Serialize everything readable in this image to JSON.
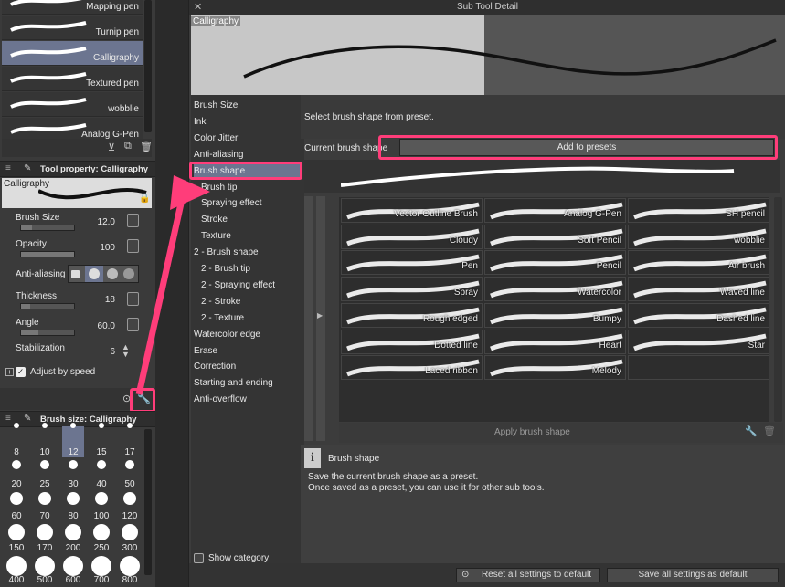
{
  "pens": [
    {
      "label": "Mapping pen",
      "selected": false
    },
    {
      "label": "Turnip pen",
      "selected": false
    },
    {
      "label": "Calligraphy",
      "selected": true
    },
    {
      "label": "Textured pen",
      "selected": false
    },
    {
      "label": "wobblie",
      "selected": false
    },
    {
      "label": "Analog G-Pen",
      "selected": false
    }
  ],
  "tool_property": {
    "header": "Tool property: Calligraphy",
    "preview_label": "Calligraphy",
    "brush_size": {
      "label": "Brush Size",
      "value": "12.0",
      "fraction": 0.2
    },
    "opacity": {
      "label": "Opacity",
      "value": "100",
      "fraction": 1.0
    },
    "anti_aliasing": {
      "label": "Anti-aliasing"
    },
    "thickness": {
      "label": "Thickness",
      "value": "18",
      "fraction": 0.18
    },
    "angle": {
      "label": "Angle",
      "value": "60.0",
      "fraction": 0.33
    },
    "stabilization": {
      "label": "Stabilization",
      "value": "6"
    },
    "adjust_by_speed": "Adjust by speed"
  },
  "brush_size_panel": {
    "header": "Brush size: Calligraphy",
    "rows": [
      [
        "8",
        "10",
        "12",
        "15",
        "17"
      ],
      [
        "20",
        "25",
        "30",
        "40",
        "50"
      ],
      [
        "60",
        "70",
        "80",
        "100",
        "120"
      ],
      [
        "150",
        "170",
        "200",
        "250",
        "300"
      ],
      [
        "400",
        "500",
        "600",
        "700",
        "800"
      ]
    ],
    "selected": "12"
  },
  "dialog": {
    "title": "Sub Tool Detail",
    "preview_label": "Calligraphy",
    "categories": [
      {
        "label": "Brush Size",
        "indent": 0
      },
      {
        "label": "Ink",
        "indent": 0
      },
      {
        "label": "Color Jitter",
        "indent": 0
      },
      {
        "label": "Anti-aliasing",
        "indent": 0
      },
      {
        "label": "Brush shape",
        "indent": 0,
        "selected": true
      },
      {
        "label": "Brush tip",
        "indent": 1
      },
      {
        "label": "Spraying effect",
        "indent": 1
      },
      {
        "label": "Stroke",
        "indent": 1
      },
      {
        "label": "Texture",
        "indent": 1
      },
      {
        "label": "2 - Brush shape",
        "indent": 0
      },
      {
        "label": "2 - Brush tip",
        "indent": 1
      },
      {
        "label": "2 - Spraying effect",
        "indent": 1
      },
      {
        "label": "2 - Stroke",
        "indent": 1
      },
      {
        "label": "2 - Texture",
        "indent": 1
      },
      {
        "label": "Watercolor edge",
        "indent": 0
      },
      {
        "label": "Erase",
        "indent": 0
      },
      {
        "label": "Correction",
        "indent": 0
      },
      {
        "label": "Starting and ending",
        "indent": 0
      },
      {
        "label": "Anti-overflow",
        "indent": 0
      }
    ],
    "show_category": "Show category",
    "instruction": "Select brush shape from preset.",
    "current_brush_shape": "Current brush shape",
    "add_to_presets": "Add to presets",
    "presets": [
      [
        "Vector Outline Brush",
        "Analog G-Pen",
        "SH pencil"
      ],
      [
        "Cloudy",
        "Soft Pencil",
        "wobblie"
      ],
      [
        "Pen",
        "Pencil",
        "Air brush"
      ],
      [
        "Spray",
        "Watercolor",
        "Waved line"
      ],
      [
        "Rough edged",
        "Bumpy",
        "Dashed line"
      ],
      [
        "Dotted line",
        "Heart",
        "Star"
      ],
      [
        "Laced ribbon",
        "Melody",
        ""
      ]
    ],
    "apply_brush_shape": "Apply brush shape",
    "info_title": "Brush shape",
    "info_line1": "Save the current brush shape as a preset.",
    "info_line2": "Once saved as a preset, you can use it for other sub tools.",
    "reset_all": "Reset all settings to default",
    "save_all": "Save all settings as default"
  },
  "colors": {
    "highlight": "#ff3d7a",
    "selected": "#6c7590"
  }
}
